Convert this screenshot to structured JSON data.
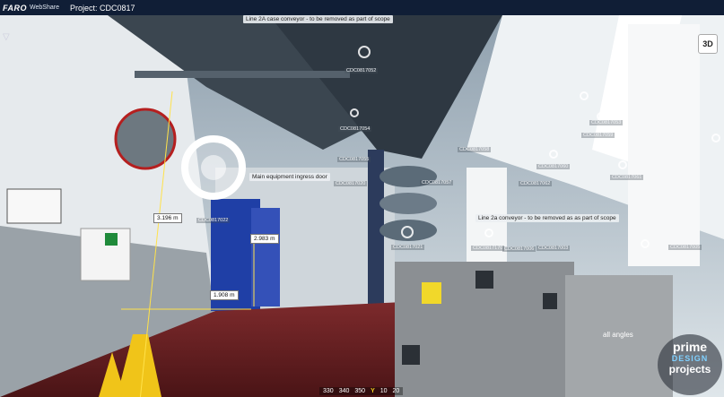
{
  "header": {
    "brand": "FARO",
    "brand_sub": "WebShare",
    "project": "Project: CDC0817"
  },
  "view_button": "3D",
  "annotations": {
    "conveyor_top": "Line 2A case conveyor - to be removed as part of scope",
    "ingress_door": "Main equipment ingress door",
    "conveyor_2a": "Line 2a conveyor - to be removed as as part of scope"
  },
  "measurements": {
    "m1": "3.196 m",
    "m2": "2.983 m",
    "m3": "1.908 m"
  },
  "tags": {
    "t052": "CDC0817052",
    "t054": "CDC0817054",
    "t053": "CDC0817053",
    "t059": "CDC0817059",
    "t058": "CDC0817058",
    "t060": "CDC0817060",
    "t061": "CDC0817061",
    "t057": "CDC0817057",
    "t055": "CDC0817055",
    "t021": "CDC0817021",
    "t022": "CDC0817022",
    "t006": "CDC0817006",
    "t003": "CDC0817003",
    "t005": "CDC0817005",
    "t170": "CDC0817170",
    "t062": "CDC0817062",
    "t020": "CDC0817020"
  },
  "compass": {
    "t330": "330",
    "t340": "340",
    "t350": "350",
    "cur": "Y",
    "t10": "10",
    "t20": "20"
  },
  "watermark": {
    "line1": "prime",
    "line2": "DESIGN",
    "line3": "projects",
    "side": "all angles"
  },
  "colors": {
    "header": "#101e36",
    "door_blue": "#1f3fa6",
    "floor_red": "#6a1a1e"
  }
}
